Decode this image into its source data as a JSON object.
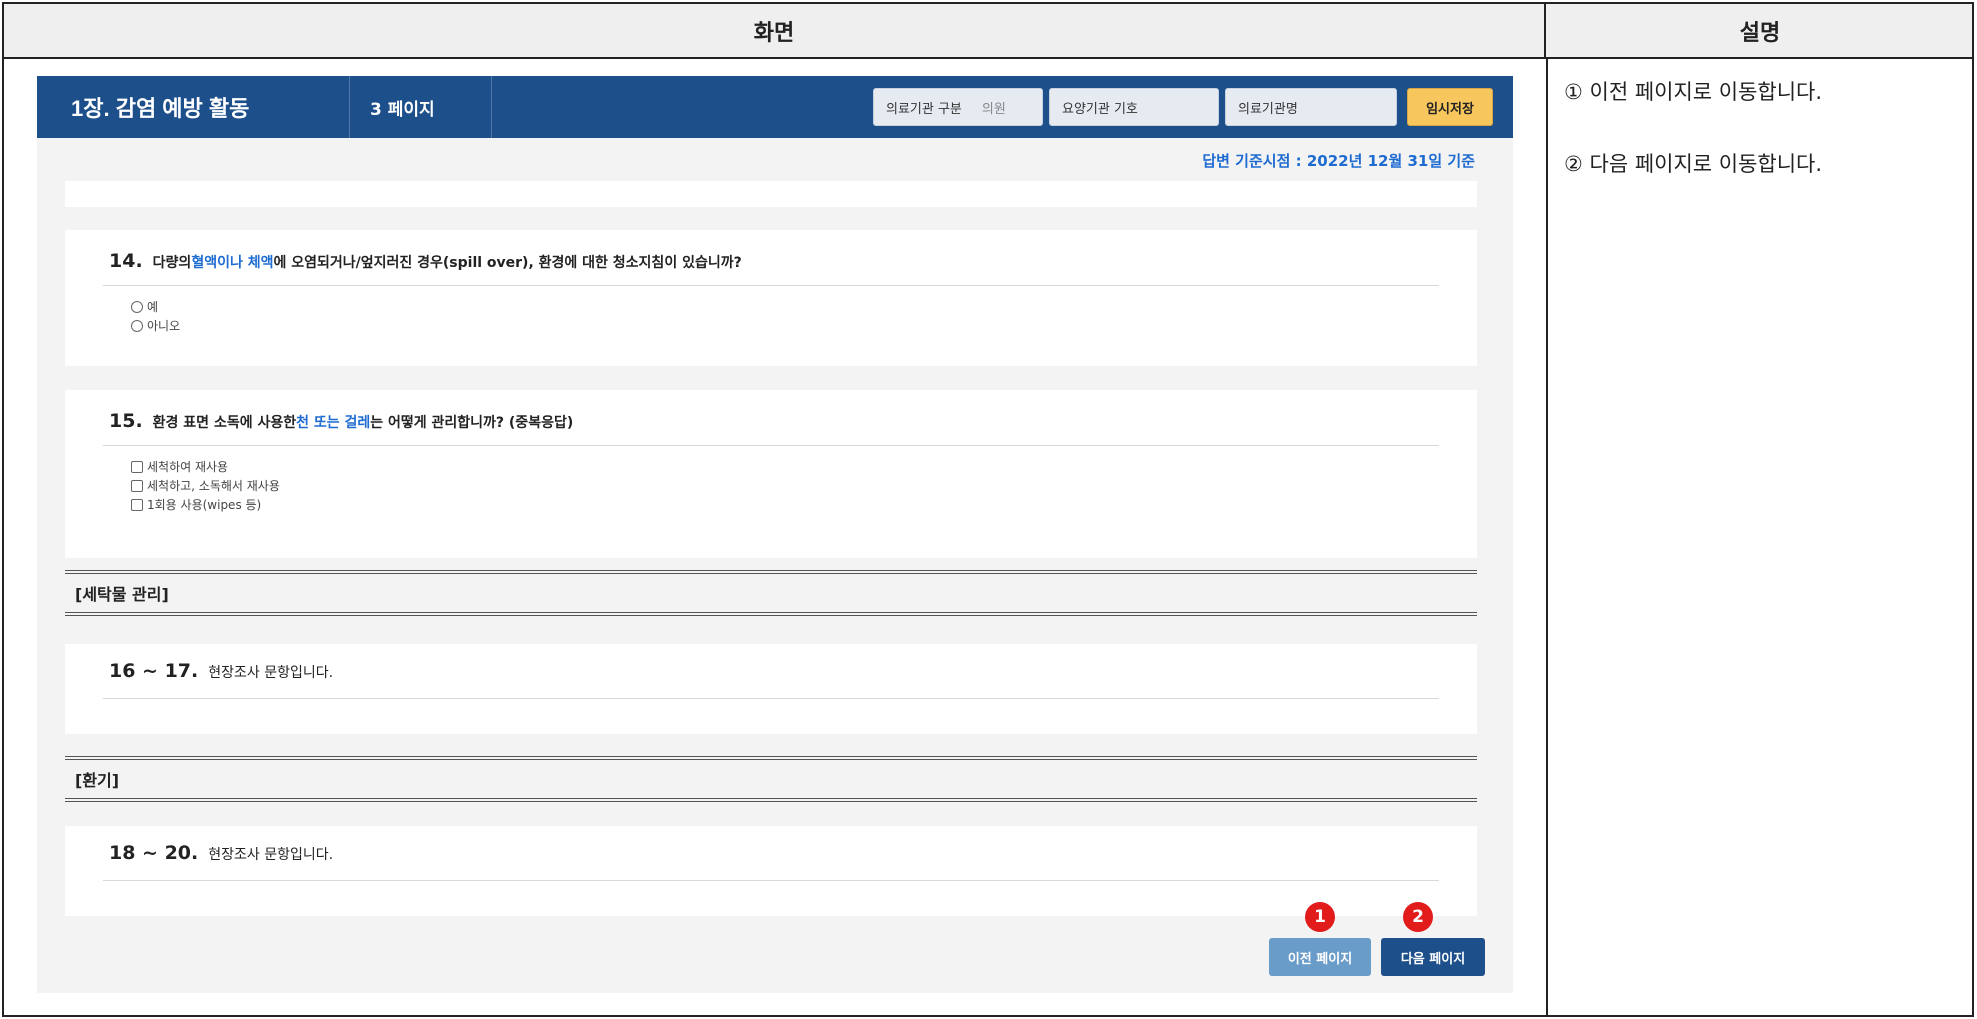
{
  "table": {
    "col_screen": "화면",
    "col_desc": "설명"
  },
  "header": {
    "chapter": "1장. 감염 예방 활동",
    "page": "3 페이지",
    "field1_label": "의료기관 구분",
    "field1_value": "의원",
    "field2_placeholder": "요양기관 기호",
    "field3_placeholder": "의료기관명",
    "save_label": "임시저장"
  },
  "basis_date": "답변 기준시점 : 2022년 12월 31일 기준",
  "q14": {
    "number": "14.",
    "text_pre": "다량의 ",
    "text_hl": "혈액이나 체액",
    "text_post": "에 오염되거나/엎지러진 경우(spill over), 환경에 대한 청소지침이 있습니까?",
    "options": [
      "예",
      "아니오"
    ]
  },
  "q15": {
    "number": "15.",
    "text_pre": "환경 표면 소독에 사용한 ",
    "text_hl": "천 또는 걸레",
    "text_post": "는 어떻게 관리합니까? (중복응답)",
    "options": [
      "세척하여 재사용",
      "세척하고, 소독해서 재사용",
      "1회용 사용(wipes 등)"
    ]
  },
  "section_laundry": "[세탁물 관리]",
  "q16": {
    "number": "16 ~ 17.",
    "text": "현장조사 문항입니다."
  },
  "section_vent": "[환기]",
  "q18": {
    "number": "18 ~ 20.",
    "text": "현장조사 문항입니다."
  },
  "nav": {
    "prev_label": "이전 페이지",
    "next_label": "다음 페이지",
    "badge1": "1",
    "badge2": "2"
  },
  "descriptions": [
    "① 이전 페이지로 이동합니다.",
    "② 다음 페이지로 이동합니다."
  ]
}
